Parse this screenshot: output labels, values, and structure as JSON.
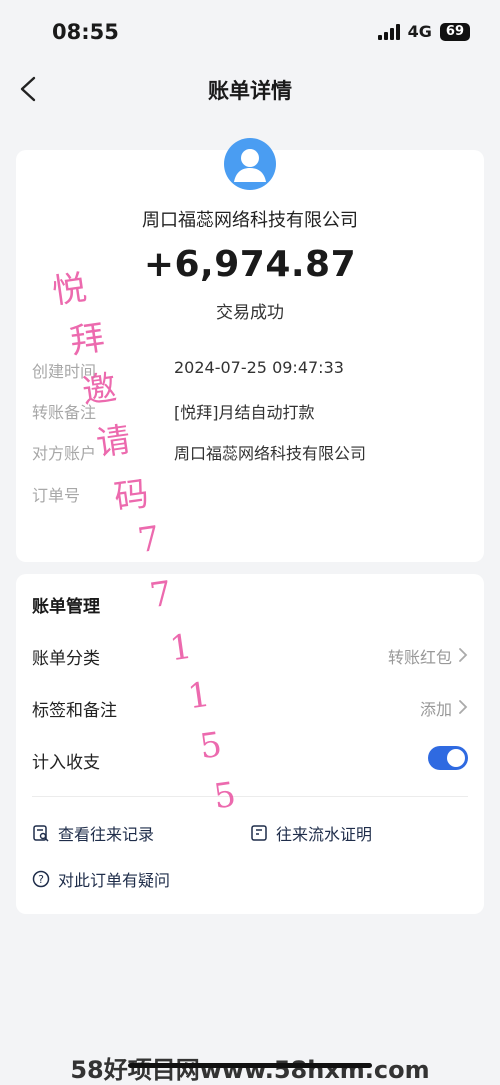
{
  "status_bar": {
    "time": "08:55",
    "network": "4G",
    "battery": "69"
  },
  "nav": {
    "title": "账单详情"
  },
  "detail": {
    "payee": "周口福蕊网络科技有限公司",
    "amount": "+6,974.87",
    "status": "交易成功",
    "rows": [
      {
        "label": "创建时间",
        "value": "2024-07-25 09:47:33"
      },
      {
        "label": "转账备注",
        "value": "[悦拜]月结自动打款"
      },
      {
        "label": "对方账户",
        "value": "周口福蕊网络科技有限公司"
      },
      {
        "label": "订单号",
        "value": ""
      }
    ]
  },
  "manage": {
    "title": "账单管理",
    "category": {
      "label": "账单分类",
      "value": "转账红包"
    },
    "tags": {
      "label": "标签和备注",
      "value": "添加"
    },
    "count": {
      "label": "计入收支",
      "enabled": true
    },
    "records_link": "查看往来记录",
    "proof_link": "往来流水证明",
    "question_link": "对此订单有疑问"
  },
  "watermark": {
    "chars": [
      "悦",
      "拜",
      "邀",
      "请",
      "码",
      "7",
      "7",
      "1",
      "1",
      "5",
      "5"
    ]
  },
  "footer": {
    "text": "58好项目网www.58hxm.com"
  },
  "colors": {
    "accent": "#2f6ae1",
    "avatar": "#4a9df2",
    "watermark": "#ea5aa6"
  }
}
